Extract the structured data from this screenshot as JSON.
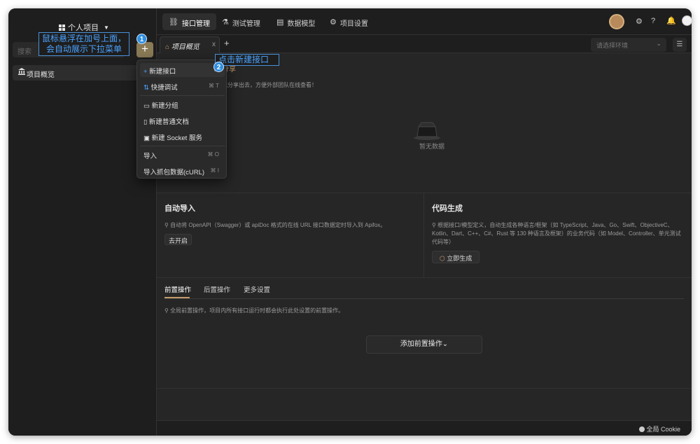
{
  "sidebar": {
    "project_title": "个人项目",
    "search_placeholder": "搜索",
    "add_button": "+",
    "items": [
      {
        "label": "项目概览"
      }
    ]
  },
  "annotations": {
    "hover_plus": "鼠标悬浮在加号上面，会自动展示下拉菜单",
    "hover_plus_line1": "鼠标悬浮在加号上面，",
    "hover_plus_line2": "会自动展示下拉菜单",
    "click_new": "点击新建接口",
    "step1": "1",
    "step2": "2"
  },
  "topbar": {
    "tabs": [
      {
        "label": "接口管理",
        "icon": "link-icon"
      },
      {
        "label": "测试管理",
        "icon": "flask-icon"
      },
      {
        "label": "数据模型",
        "icon": "model-icon"
      },
      {
        "label": "项目设置",
        "icon": "gear-icon"
      }
    ]
  },
  "tabstrip": {
    "open_tab": "项目概览",
    "close": "x",
    "add": "+",
    "env_placeholder": "请选择环境"
  },
  "dropdown": {
    "items": [
      {
        "label": "新建接口",
        "shortcut": "⌘"
      },
      {
        "label": "快捷调试",
        "shortcut": "⌘ T"
      },
      {
        "label": "新建分组",
        "shortcut": ""
      },
      {
        "label": "新建普通文档",
        "shortcut": ""
      },
      {
        "label": "新建 Socket 服务",
        "shortcut": ""
      },
      {
        "label": "导入",
        "shortcut": "⌘ O"
      },
      {
        "label": "导入抓包数据(cURL)",
        "shortcut": "⌘ I"
      }
    ]
  },
  "overview": {
    "share_title": "分享",
    "share_desc": "式分享出去，方便外部团队在线查看！",
    "empty_text": "暂无数据"
  },
  "auto_import": {
    "title": "自动导入",
    "desc": "自动将 OpenAPI（Swagger）或 apiDoc 格式的在线 URL 接口数据定时导入到 Apifox。",
    "button": "去开启"
  },
  "codegen": {
    "title": "代码生成",
    "desc": "根据接口/模型定义，自动生成各种语言/框架（如 TypeScript、Java、Go、Swift、ObjectiveC、Kotlin、Dart、C++、C#、Rust 等 130 种语言及框架）的业务代码（如 Model、Controller、单元测试代码等）",
    "button": "立即生成"
  },
  "ops": {
    "tabs": [
      "前置操作",
      "后置操作",
      "更多设置"
    ],
    "desc": "全局前置操作，项目内所有接口运行时都会执行此处设置的前置操作。",
    "add_button": "添加前置操作"
  },
  "bottombar": {
    "cookie": "全局 Cookie"
  },
  "colors": {
    "accent": "#c59b6b",
    "annotation": "#4aa3ff",
    "background": "#262626"
  }
}
